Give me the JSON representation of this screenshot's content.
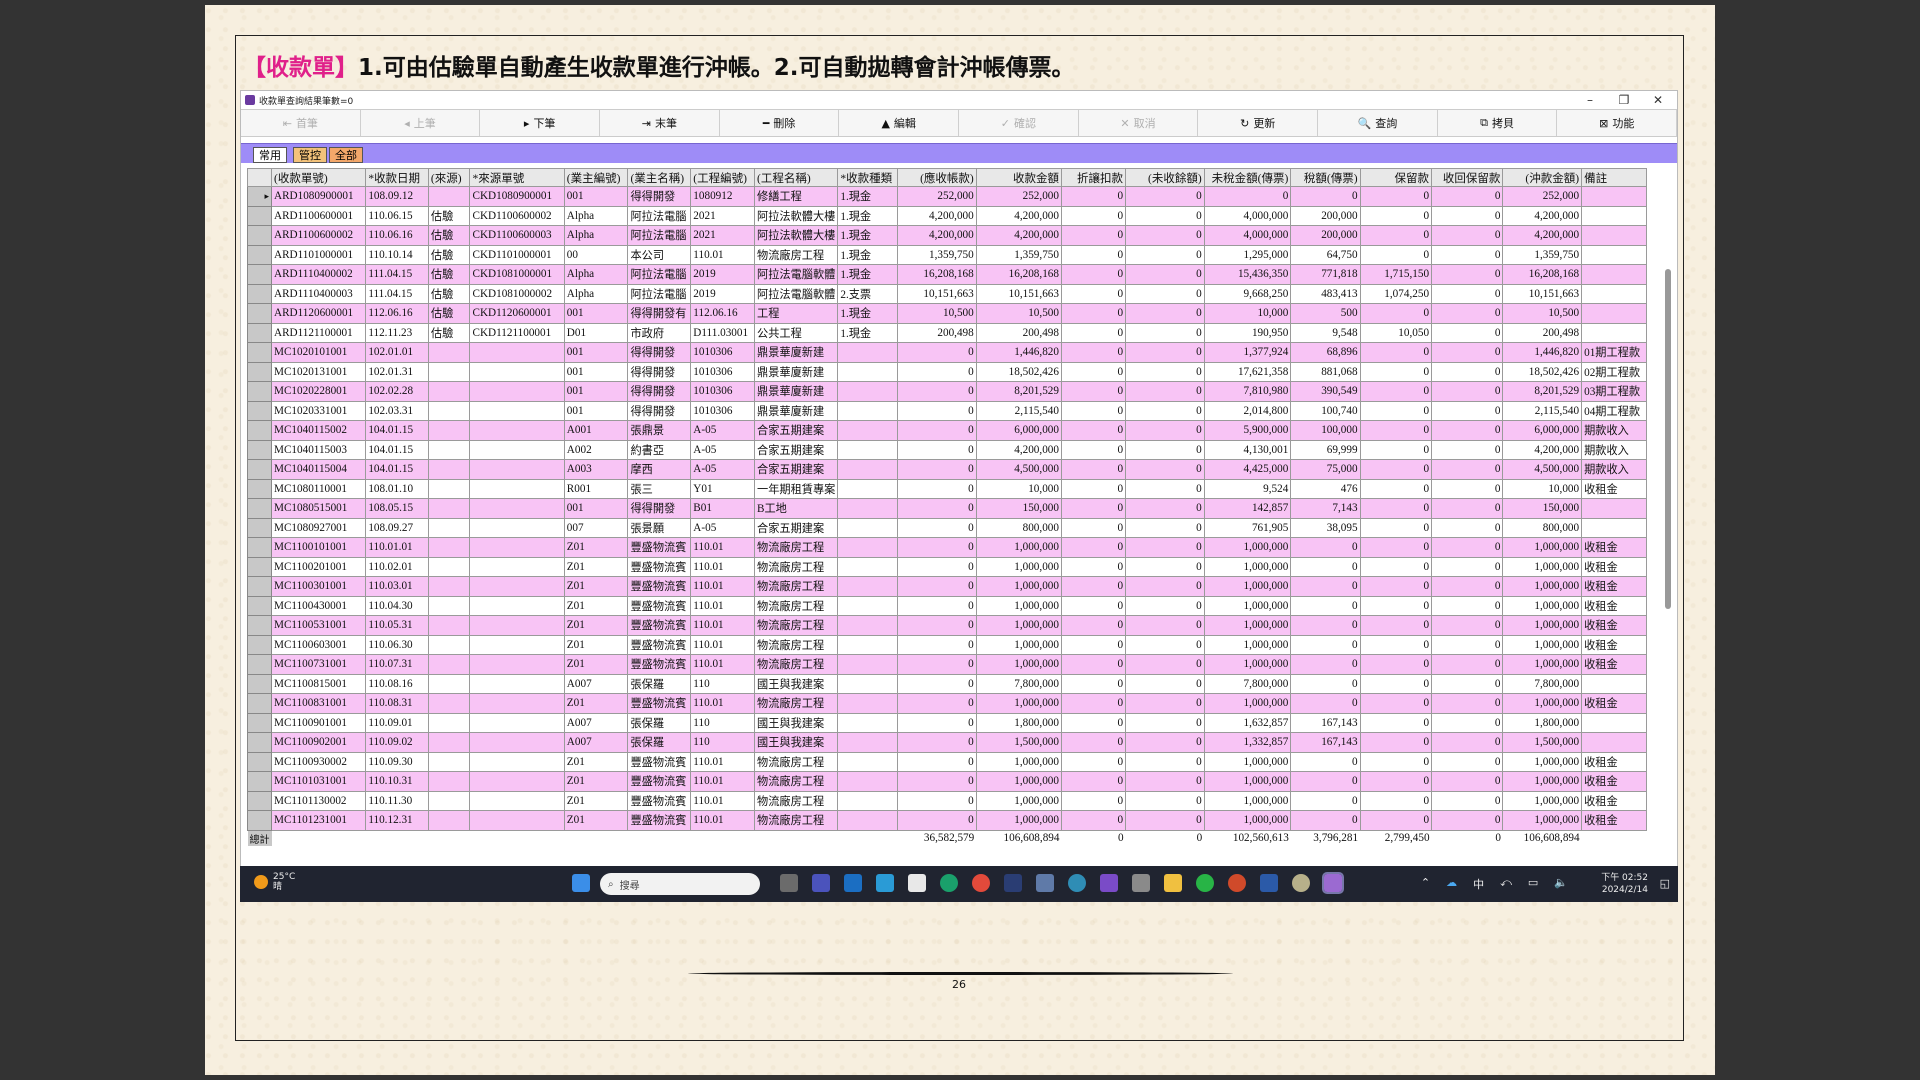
{
  "slide": {
    "title_bracket": "【收款單】",
    "title_text": "1.可由估驗單自動產生收款單進行沖帳。2.可自動拋轉會計沖帳傳票。",
    "page_number": "26"
  },
  "window": {
    "title": "收款單查詢結果筆數=0"
  },
  "toolbar": [
    {
      "icon": "first-icon",
      "glyph": "⇤",
      "label": "首筆",
      "enabled": false
    },
    {
      "icon": "prev-icon",
      "glyph": "◂",
      "label": "上筆",
      "enabled": false
    },
    {
      "icon": "next-icon",
      "glyph": "▸",
      "label": "下筆",
      "enabled": true
    },
    {
      "icon": "last-icon",
      "glyph": "⇥",
      "label": "末筆",
      "enabled": true
    },
    {
      "icon": "delete-icon",
      "glyph": "━",
      "label": "刪除",
      "enabled": true
    },
    {
      "icon": "edit-icon",
      "glyph": "▲",
      "label": "編輯",
      "enabled": true
    },
    {
      "icon": "confirm-icon",
      "glyph": "✓",
      "label": "確認",
      "enabled": false
    },
    {
      "icon": "cancel-icon",
      "glyph": "✕",
      "label": "取消",
      "enabled": false
    },
    {
      "icon": "refresh-icon",
      "glyph": "↻",
      "label": "更新",
      "enabled": true
    },
    {
      "icon": "search-icon",
      "glyph": "🔍",
      "label": "查詢",
      "enabled": true
    },
    {
      "icon": "copy-icon",
      "glyph": "⧉",
      "label": "拷貝",
      "enabled": true
    },
    {
      "icon": "function-icon",
      "glyph": "⊠",
      "label": "功能",
      "enabled": true
    }
  ],
  "tabs": [
    {
      "label": "常用",
      "color": "#ffffff"
    },
    {
      "label": "管控",
      "color": "#f3c27a"
    },
    {
      "label": "全部",
      "color": "#f3a76a"
    }
  ],
  "columns": [
    "(收款單號)",
    "*收款日期",
    "(來源)",
    "*來源單號",
    "(業主編號)",
    "(業主名稱)",
    "(工程編號)",
    "(工程名稱)",
    "*收款種類",
    "(應收帳款)",
    "收款金額",
    "折讓扣款",
    "(未收餘額)",
    "未稅金額(傳票)",
    "稅額(傳票)",
    "保留款",
    "收回保留款",
    "(沖款金額)",
    "備註"
  ],
  "rows": [
    [
      "ARD1080900001",
      "108.09.12",
      "",
      "CKD1080900001",
      "001",
      "得得開發",
      "1080912",
      "修繕工程",
      "1.現金",
      "252,000",
      "252,000",
      "0",
      "0",
      "0",
      "0",
      "0",
      "0",
      "252,000",
      ""
    ],
    [
      "ARD1100600001",
      "110.06.15",
      "估驗",
      "CKD1100600002",
      "Alpha",
      "阿拉法電腦",
      "2021",
      "阿拉法軟體大樓",
      "1.現金",
      "4,200,000",
      "4,200,000",
      "0",
      "0",
      "4,000,000",
      "200,000",
      "0",
      "0",
      "4,200,000",
      ""
    ],
    [
      "ARD1100600002",
      "110.06.16",
      "估驗",
      "CKD1100600003",
      "Alpha",
      "阿拉法電腦",
      "2021",
      "阿拉法軟體大樓",
      "1.現金",
      "4,200,000",
      "4,200,000",
      "0",
      "0",
      "4,000,000",
      "200,000",
      "0",
      "0",
      "4,200,000",
      ""
    ],
    [
      "ARD1101000001",
      "110.10.14",
      "估驗",
      "CKD1101000001",
      "00",
      "本公司",
      "110.01",
      "物流廠房工程",
      "1.現金",
      "1,359,750",
      "1,359,750",
      "0",
      "0",
      "1,295,000",
      "64,750",
      "0",
      "0",
      "1,359,750",
      ""
    ],
    [
      "ARD1110400002",
      "111.04.15",
      "估驗",
      "CKD1081000001",
      "Alpha",
      "阿拉法電腦",
      "2019",
      "阿拉法電腦軟體",
      "1.現金",
      "16,208,168",
      "16,208,168",
      "0",
      "0",
      "15,436,350",
      "771,818",
      "1,715,150",
      "0",
      "16,208,168",
      ""
    ],
    [
      "ARD1110400003",
      "111.04.15",
      "估驗",
      "CKD1081000002",
      "Alpha",
      "阿拉法電腦",
      "2019",
      "阿拉法電腦軟體",
      "2.支票",
      "10,151,663",
      "10,151,663",
      "0",
      "0",
      "9,668,250",
      "483,413",
      "1,074,250",
      "0",
      "10,151,663",
      ""
    ],
    [
      "ARD1120600001",
      "112.06.16",
      "估驗",
      "CKD1120600001",
      "001",
      "得得開發有",
      "112.06.16",
      "工程",
      "1.現金",
      "10,500",
      "10,500",
      "0",
      "0",
      "10,000",
      "500",
      "0",
      "0",
      "10,500",
      ""
    ],
    [
      "ARD1121100001",
      "112.11.23",
      "估驗",
      "CKD1121100001",
      "D01",
      "市政府",
      "D111.03001",
      "公共工程",
      "1.現金",
      "200,498",
      "200,498",
      "0",
      "0",
      "190,950",
      "9,548",
      "10,050",
      "0",
      "200,498",
      ""
    ],
    [
      "MC1020101001",
      "102.01.01",
      "",
      "",
      "001",
      "得得開發",
      "1010306",
      "鼎景華廈新建",
      "",
      "0",
      "1,446,820",
      "0",
      "0",
      "1,377,924",
      "68,896",
      "0",
      "0",
      "1,446,820",
      "01期工程款"
    ],
    [
      "MC1020131001",
      "102.01.31",
      "",
      "",
      "001",
      "得得開發",
      "1010306",
      "鼎景華廈新建",
      "",
      "0",
      "18,502,426",
      "0",
      "0",
      "17,621,358",
      "881,068",
      "0",
      "0",
      "18,502,426",
      "02期工程款"
    ],
    [
      "MC1020228001",
      "102.02.28",
      "",
      "",
      "001",
      "得得開發",
      "1010306",
      "鼎景華廈新建",
      "",
      "0",
      "8,201,529",
      "0",
      "0",
      "7,810,980",
      "390,549",
      "0",
      "0",
      "8,201,529",
      "03期工程款"
    ],
    [
      "MC1020331001",
      "102.03.31",
      "",
      "",
      "001",
      "得得開發",
      "1010306",
      "鼎景華廈新建",
      "",
      "0",
      "2,115,540",
      "0",
      "0",
      "2,014,800",
      "100,740",
      "0",
      "0",
      "2,115,540",
      "04期工程款"
    ],
    [
      "MC1040115002",
      "104.01.15",
      "",
      "",
      "A001",
      "張鼎景",
      "A-05",
      "合家五期建案",
      "",
      "0",
      "6,000,000",
      "0",
      "0",
      "5,900,000",
      "100,000",
      "0",
      "0",
      "6,000,000",
      "期款收入"
    ],
    [
      "MC1040115003",
      "104.01.15",
      "",
      "",
      "A002",
      "約書亞",
      "A-05",
      "合家五期建案",
      "",
      "0",
      "4,200,000",
      "0",
      "0",
      "4,130,001",
      "69,999",
      "0",
      "0",
      "4,200,000",
      "期款收入"
    ],
    [
      "MC1040115004",
      "104.01.15",
      "",
      "",
      "A003",
      "摩西",
      "A-05",
      "合家五期建案",
      "",
      "0",
      "4,500,000",
      "0",
      "0",
      "4,425,000",
      "75,000",
      "0",
      "0",
      "4,500,000",
      "期款收入"
    ],
    [
      "MC1080110001",
      "108.01.10",
      "",
      "",
      "R001",
      "張三",
      "Y01",
      "一年期租賃專案",
      "",
      "0",
      "10,000",
      "0",
      "0",
      "9,524",
      "476",
      "0",
      "0",
      "10,000",
      "收租金"
    ],
    [
      "MC1080515001",
      "108.05.15",
      "",
      "",
      "001",
      "得得開發",
      "B01",
      "B工地",
      "",
      "0",
      "150,000",
      "0",
      "0",
      "142,857",
      "7,143",
      "0",
      "0",
      "150,000",
      ""
    ],
    [
      "MC1080927001",
      "108.09.27",
      "",
      "",
      "007",
      "張景願",
      "A-05",
      "合家五期建案",
      "",
      "0",
      "800,000",
      "0",
      "0",
      "761,905",
      "38,095",
      "0",
      "0",
      "800,000",
      ""
    ],
    [
      "MC1100101001",
      "110.01.01",
      "",
      "",
      "Z01",
      "豐盛物流賓",
      "110.01",
      "物流廠房工程",
      "",
      "0",
      "1,000,000",
      "0",
      "0",
      "1,000,000",
      "0",
      "0",
      "0",
      "1,000,000",
      "收租金"
    ],
    [
      "MC1100201001",
      "110.02.01",
      "",
      "",
      "Z01",
      "豐盛物流賓",
      "110.01",
      "物流廠房工程",
      "",
      "0",
      "1,000,000",
      "0",
      "0",
      "1,000,000",
      "0",
      "0",
      "0",
      "1,000,000",
      "收租金"
    ],
    [
      "MC1100301001",
      "110.03.01",
      "",
      "",
      "Z01",
      "豐盛物流賓",
      "110.01",
      "物流廠房工程",
      "",
      "0",
      "1,000,000",
      "0",
      "0",
      "1,000,000",
      "0",
      "0",
      "0",
      "1,000,000",
      "收租金"
    ],
    [
      "MC1100430001",
      "110.04.30",
      "",
      "",
      "Z01",
      "豐盛物流賓",
      "110.01",
      "物流廠房工程",
      "",
      "0",
      "1,000,000",
      "0",
      "0",
      "1,000,000",
      "0",
      "0",
      "0",
      "1,000,000",
      "收租金"
    ],
    [
      "MC1100531001",
      "110.05.31",
      "",
      "",
      "Z01",
      "豐盛物流賓",
      "110.01",
      "物流廠房工程",
      "",
      "0",
      "1,000,000",
      "0",
      "0",
      "1,000,000",
      "0",
      "0",
      "0",
      "1,000,000",
      "收租金"
    ],
    [
      "MC1100603001",
      "110.06.30",
      "",
      "",
      "Z01",
      "豐盛物流賓",
      "110.01",
      "物流廠房工程",
      "",
      "0",
      "1,000,000",
      "0",
      "0",
      "1,000,000",
      "0",
      "0",
      "0",
      "1,000,000",
      "收租金"
    ],
    [
      "MC1100731001",
      "110.07.31",
      "",
      "",
      "Z01",
      "豐盛物流賓",
      "110.01",
      "物流廠房工程",
      "",
      "0",
      "1,000,000",
      "0",
      "0",
      "1,000,000",
      "0",
      "0",
      "0",
      "1,000,000",
      "收租金"
    ],
    [
      "MC1100815001",
      "110.08.16",
      "",
      "",
      "A007",
      "張保羅",
      "110",
      "國王與我建案",
      "",
      "0",
      "7,800,000",
      "0",
      "0",
      "7,800,000",
      "0",
      "0",
      "0",
      "7,800,000",
      ""
    ],
    [
      "MC1100831001",
      "110.08.31",
      "",
      "",
      "Z01",
      "豐盛物流賓",
      "110.01",
      "物流廠房工程",
      "",
      "0",
      "1,000,000",
      "0",
      "0",
      "1,000,000",
      "0",
      "0",
      "0",
      "1,000,000",
      "收租金"
    ],
    [
      "MC1100901001",
      "110.09.01",
      "",
      "",
      "A007",
      "張保羅",
      "110",
      "國王與我建案",
      "",
      "0",
      "1,800,000",
      "0",
      "0",
      "1,632,857",
      "167,143",
      "0",
      "0",
      "1,800,000",
      ""
    ],
    [
      "MC1100902001",
      "110.09.02",
      "",
      "",
      "A007",
      "張保羅",
      "110",
      "國王與我建案",
      "",
      "0",
      "1,500,000",
      "0",
      "0",
      "1,332,857",
      "167,143",
      "0",
      "0",
      "1,500,000",
      ""
    ],
    [
      "MC1100930002",
      "110.09.30",
      "",
      "",
      "Z01",
      "豐盛物流賓",
      "110.01",
      "物流廠房工程",
      "",
      "0",
      "1,000,000",
      "0",
      "0",
      "1,000,000",
      "0",
      "0",
      "0",
      "1,000,000",
      "收租金"
    ],
    [
      "MC1101031001",
      "110.10.31",
      "",
      "",
      "Z01",
      "豐盛物流賓",
      "110.01",
      "物流廠房工程",
      "",
      "0",
      "1,000,000",
      "0",
      "0",
      "1,000,000",
      "0",
      "0",
      "0",
      "1,000,000",
      "收租金"
    ],
    [
      "MC1101130002",
      "110.11.30",
      "",
      "",
      "Z01",
      "豐盛物流賓",
      "110.01",
      "物流廠房工程",
      "",
      "0",
      "1,000,000",
      "0",
      "0",
      "1,000,000",
      "0",
      "0",
      "0",
      "1,000,000",
      "收租金"
    ],
    [
      "MC1101231001",
      "110.12.31",
      "",
      "",
      "Z01",
      "豐盛物流賓",
      "110.01",
      "物流廠房工程",
      "",
      "0",
      "1,000,000",
      "0",
      "0",
      "1,000,000",
      "0",
      "0",
      "0",
      "1,000,000",
      "收租金"
    ]
  ],
  "totals": {
    "label": "總計",
    "values": [
      "36,582,579",
      "106,608,894",
      "0",
      "0",
      "102,560,613",
      "3,796,281",
      "2,799,450",
      "0",
      "106,608,894"
    ]
  },
  "taskbar": {
    "temperature": "25°C",
    "weather": "晴",
    "search_placeholder": "搜尋",
    "ime": "中",
    "time": "下午 02:52",
    "date": "2024/2/14"
  }
}
